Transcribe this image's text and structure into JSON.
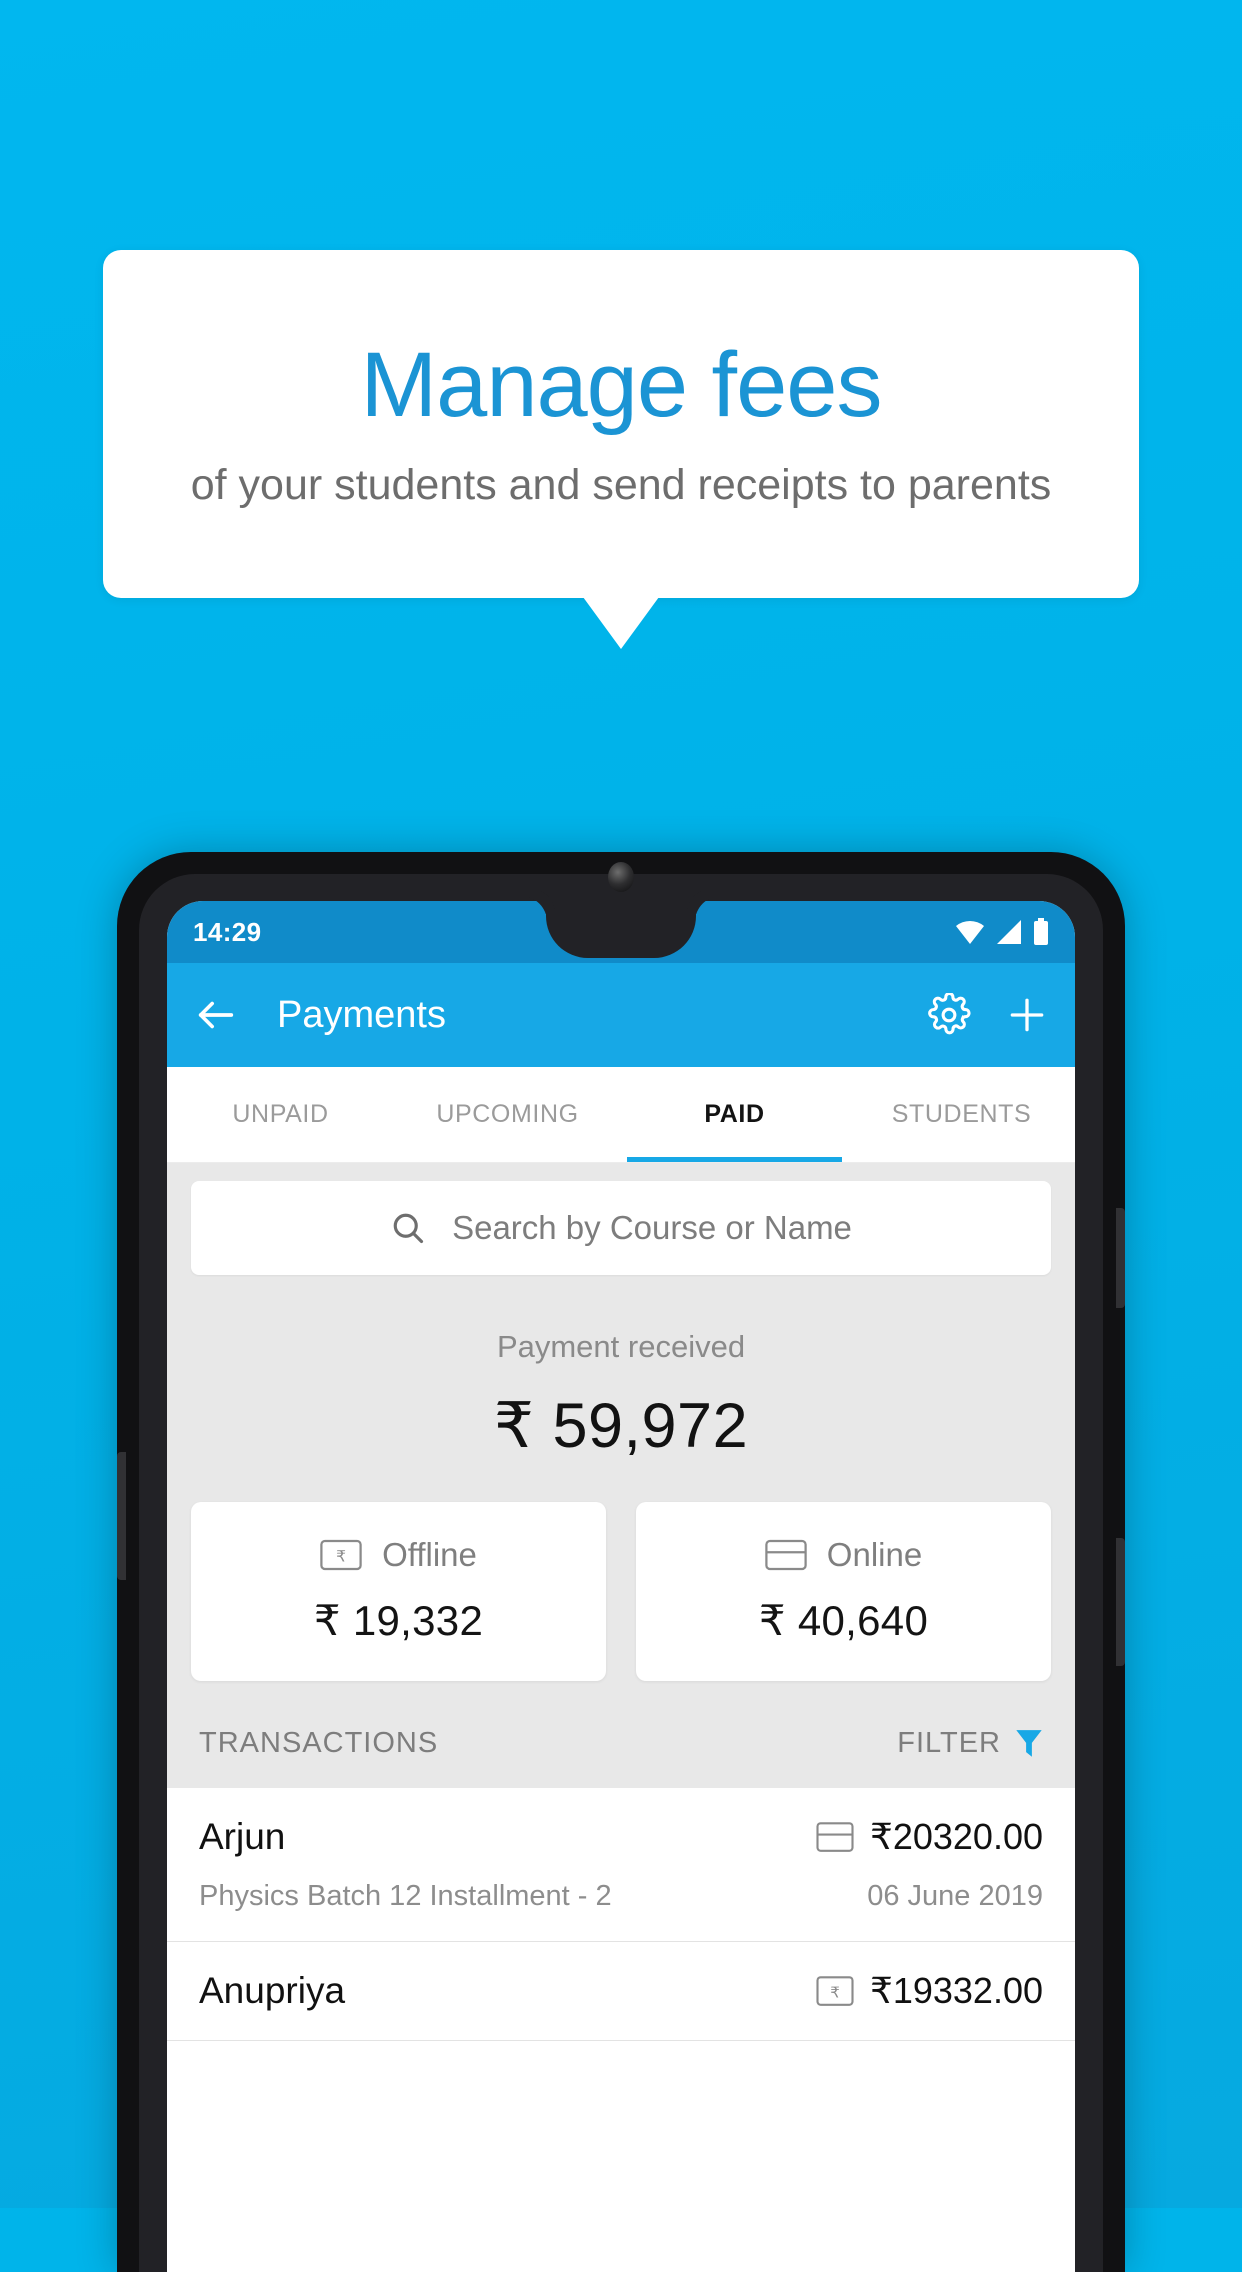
{
  "promo": {
    "title": "Manage fees",
    "subtitle": "of your students and send receipts to parents",
    "title_color": "#1b94d4",
    "background_color": "#00b4ea"
  },
  "phone": {
    "status_bar": {
      "time": "14:29",
      "icons": [
        "wifi-icon",
        "signal-icon",
        "battery-icon"
      ],
      "background_color": "#108bc9"
    },
    "app_bar": {
      "title": "Payments",
      "back_icon": "back-arrow-icon",
      "actions": [
        "gear-icon",
        "plus-icon"
      ],
      "background_color": "#17a8e6"
    },
    "tabs": [
      {
        "label": "UNPAID",
        "active": false
      },
      {
        "label": "UPCOMING",
        "active": false
      },
      {
        "label": "PAID",
        "active": true
      },
      {
        "label": "STUDENTS",
        "active": false
      }
    ],
    "search": {
      "placeholder": "Search by Course or Name",
      "icon": "search-icon"
    },
    "summary": {
      "label": "Payment received",
      "amount": "₹ 59,972"
    },
    "methods": [
      {
        "label": "Offline",
        "amount": "₹ 19,332",
        "icon": "cash-note-icon"
      },
      {
        "label": "Online",
        "amount": "₹ 40,640",
        "icon": "credit-card-icon"
      }
    ],
    "list_header": {
      "transactions_label": "TRANSACTIONS",
      "filter_label": "FILTER",
      "filter_icon": "funnel-icon",
      "filter_icon_color": "#17a8e6"
    },
    "transactions": [
      {
        "name": "Arjun",
        "amount": "₹20320.00",
        "method_icon": "credit-card-icon",
        "course": "Physics Batch 12 Installment - 2",
        "date": "06 June 2019"
      },
      {
        "name": "Anupriya",
        "amount": "₹19332.00",
        "method_icon": "cash-note-icon",
        "course": "",
        "date": ""
      }
    ]
  }
}
